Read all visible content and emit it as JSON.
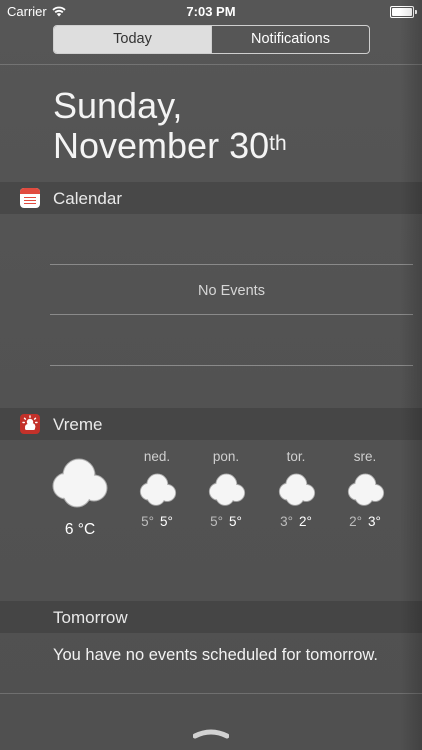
{
  "status_bar": {
    "carrier": "Carrier",
    "time": "7:03 PM",
    "battery_level": 1.0
  },
  "tabs": [
    {
      "label": "Today",
      "selected": true
    },
    {
      "label": "Notifications",
      "selected": false
    }
  ],
  "date": {
    "weekday": "Sunday,",
    "month_day": "November 30",
    "suffix": "th"
  },
  "calendar": {
    "title": "Calendar",
    "empty_text": "No Events"
  },
  "weather": {
    "title": "Vreme",
    "current": {
      "temp": "6 °C",
      "icon": "cloud-icon"
    },
    "forecast": [
      {
        "day": "ned.",
        "low": "5°",
        "high": "5°",
        "icon": "cloud-icon"
      },
      {
        "day": "pon.",
        "low": "5°",
        "high": "5°",
        "icon": "cloud-icon"
      },
      {
        "day": "tor.",
        "low": "3°",
        "high": "2°",
        "icon": "cloud-icon"
      },
      {
        "day": "sre.",
        "low": "2°",
        "high": "3°",
        "icon": "cloud-icon"
      }
    ]
  },
  "tomorrow": {
    "title": "Tomorrow",
    "message": "You have no events scheduled for tomorrow."
  },
  "colors": {
    "background": "#545454",
    "calendar_accent": "#e14b3f",
    "weather_accent": "#c3312a"
  }
}
